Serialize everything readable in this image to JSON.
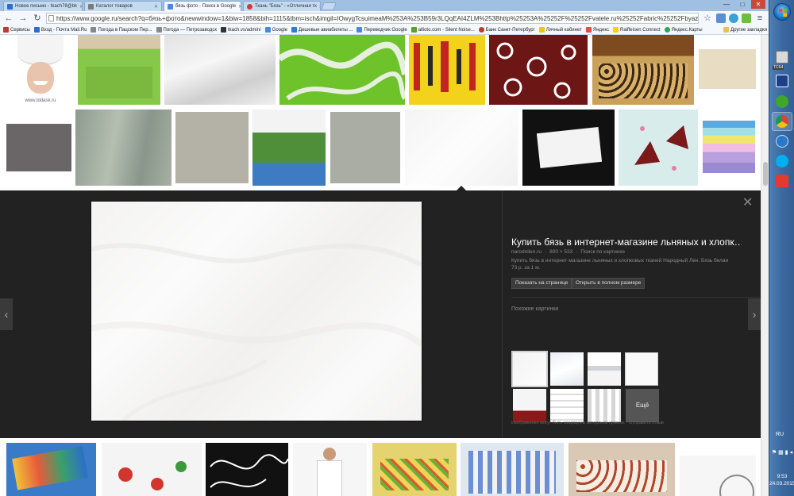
{
  "browser": {
    "tabs": [
      {
        "label": "Новое письмо - tkach78@bk",
        "color": "#2a6fc9",
        "active": false
      },
      {
        "label": "Каталог товаров",
        "color": "#7a7a7a",
        "active": false
      },
      {
        "label": "бязь фото - Поиск в Google",
        "color": "#4a88e0",
        "active": true
      },
      {
        "label": "Ткань \"Бязь\" - «Отличная тк",
        "color": "#d23a3a",
        "active": false
      }
    ],
    "url": "https://www.google.ru/search?q=бязь+фото&newwindow=1&biw=1858&bih=1115&tbm=isch&imgil=IOwygTcsuimeaM%253A%253B59r3LQqEAI4ZLM%253Bhttp%25253A%25252F%25252Fvatele.ru%25252Fabric%25252Fbyaz",
    "window_controls": [
      "—",
      "□",
      "✕"
    ],
    "bookmarks": [
      {
        "label": "Сервисы",
        "color": "#c0392b"
      },
      {
        "label": "Вход - Почта Mail.Ru",
        "color": "#2a6fc9"
      },
      {
        "label": "Погода в Пацском Пер...",
        "color": "#888888"
      },
      {
        "label": "Погода — Петрозаводск",
        "color": "#888888"
      },
      {
        "label": "tkach.vs/admin/",
        "color": "#333333"
      },
      {
        "label": "Google",
        "color": "#4a88e0"
      },
      {
        "label": "Дешевые авиабилеты ...",
        "color": "#2a7fc9"
      },
      {
        "label": "Переводчик Google",
        "color": "#4a88e0"
      },
      {
        "label": "allioto.com - Silent Noise...",
        "color": "#5aa02c"
      },
      {
        "label": "Банк Санкт-Петербург",
        "color": "#c0392b"
      },
      {
        "label": "Личный кабинет",
        "color": "#f1c40f"
      },
      {
        "label": "Яндекс",
        "color": "#e74c3c"
      },
      {
        "label": "Raiffeisen Connect",
        "color": "#f5d20f"
      },
      {
        "label": "Яндекс.Карты",
        "color": "#2ca84a"
      }
    ],
    "other_bookmarks": "Другие закладки"
  },
  "top_row_captions": {
    "tddask": "www.tddask.ru"
  },
  "preview": {
    "title": "Купить бязь в интернет-магазине льняных и хлопк…",
    "source": "narodnilen.ru",
    "size": "800 × 533",
    "search_by_image": "Поиск по картинке",
    "description": "Купить бязь в интернет-магазине льняных и хлопковых тканей Народный Лен. Бязь белая 73 р. за 1 м.",
    "visit_button": "Показать на странице",
    "fullsize_button": "Открыть в полном размере",
    "similar_label": "Похожие картинки",
    "more_label": "Ещё",
    "footer": "Изображения могут быть защищены авторским правом. · Отправить отзыв",
    "close_glyph": "✕",
    "prev_glyph": "‹",
    "next_glyph": "›"
  },
  "taskbar": {
    "tc_label": "TC64",
    "language": "RU",
    "time": "9:53",
    "date": "24.03.2015"
  }
}
